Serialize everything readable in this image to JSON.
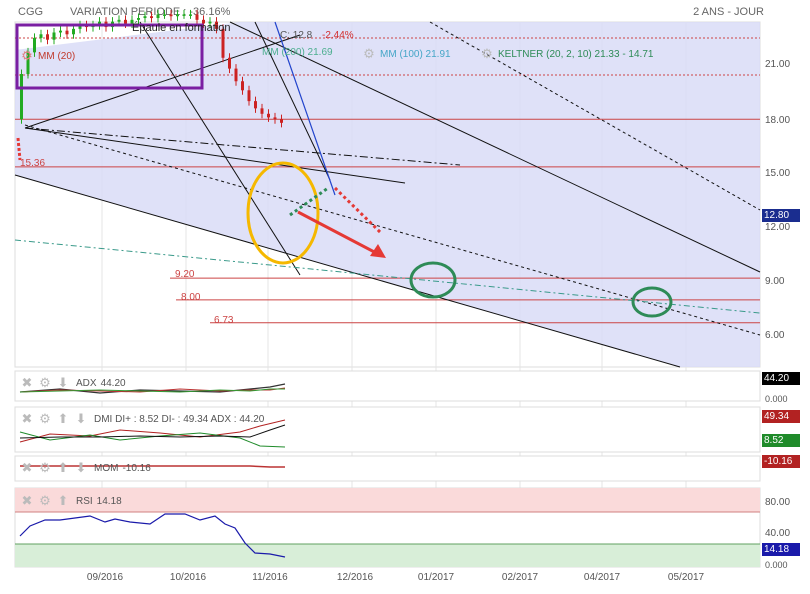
{
  "header": {
    "symbol": "CGG",
    "variation": "VARIATION PERIODE : -36.16%",
    "period": "2 ANS - JOUR"
  },
  "overlay": {
    "pattern_label": "Épaule en formation",
    "price_label": "C: 12.8",
    "change": "-2.44%",
    "mm20": "MM (20)",
    "mm200": "MM (200) 21.69",
    "mm100": "MM (100) 21.91",
    "keltner": "KELTNER (20, 2, 10) 21.33 - 14.71"
  },
  "price_levels": [
    {
      "label": "15.36"
    },
    {
      "label": "9.20"
    },
    {
      "label": "8.00"
    },
    {
      "label": "6.73"
    }
  ],
  "indicators": {
    "adx": {
      "label": "ADX",
      "value": "44.20",
      "badge": "44.20",
      "ticks": [
        "0.000"
      ]
    },
    "dmi": {
      "label": "DMI DI+ : 8.52 DI- : 49.34 ADX : 44.20",
      "badge_red": "49.34",
      "badge_green": "8.52"
    },
    "mom": {
      "label": "MOM",
      "value": "-10.16",
      "badge": "-10.16"
    },
    "rsi": {
      "label": "RSI",
      "value": "14.18",
      "badge": "14.18",
      "ticks": [
        "80.00",
        "40.00",
        "0.000"
      ]
    }
  },
  "colors": {
    "channel_fill": "#d9dcf7",
    "up": "#22aa22",
    "down": "#cc2222",
    "level_line": "#cc4444",
    "ellipse": "#f5b800",
    "circle": "#2e8b57",
    "rsi_line": "#1a1aaa",
    "rsi_upper": "#fadada",
    "rsi_lower": "#d8eed8"
  },
  "chart_data": {
    "type": "line",
    "y_ticks": [
      "21.00",
      "18.00",
      "15.00",
      "12.00",
      "9.00",
      "6.00"
    ],
    "last_price_badge": "12.80",
    "x_ticks": [
      "09/2016",
      "10/2016",
      "11/2016",
      "12/2016",
      "01/2017",
      "02/2017",
      "04/2017",
      "05/2017"
    ],
    "price_series_approx": [
      {
        "x": "08/2016",
        "close": 18.2
      },
      {
        "x": "09/2016",
        "close": 21.0
      },
      {
        "x": "10/2016",
        "close": 21.5
      },
      {
        "x": "10/2016 late",
        "close": 21.8
      },
      {
        "x": "11/2016 start",
        "close": 19.5
      },
      {
        "x": "11/2016 mid",
        "close": 12.8
      }
    ],
    "horizontal_levels": [
      15.36,
      9.2,
      8.0,
      6.73
    ],
    "rsi_levels": [
      80,
      40
    ],
    "last_values": {
      "adx": 44.2,
      "di_minus": 49.34,
      "di_plus": 8.52,
      "mom": -10.16,
      "rsi": 14.18
    }
  }
}
